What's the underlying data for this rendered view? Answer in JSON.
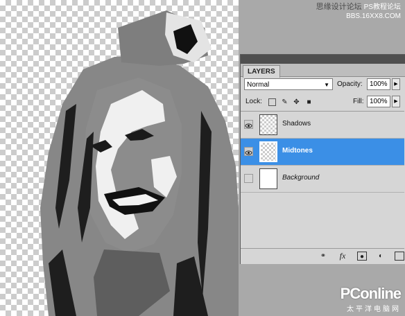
{
  "watermark": {
    "top_text": "思缘设计论坛",
    "top_site": "PS教程论坛",
    "top_url": "BBS.16XX8.COM",
    "bottom_logo": "PConline",
    "bottom_sub": "太平洋电脑网"
  },
  "layers_panel": {
    "tab_label": "LAYERS",
    "blend_mode": "Normal",
    "opacity_label": "Opacity:",
    "opacity_value": "100%",
    "lock_label": "Lock:",
    "fill_label": "Fill:",
    "fill_value": "100%",
    "layers": [
      {
        "name": "Shadows",
        "visible": true,
        "selected": false
      },
      {
        "name": "Midtones",
        "visible": true,
        "selected": true
      },
      {
        "name": "Background",
        "visible": false,
        "selected": false
      }
    ],
    "bottom_icons": [
      "link-icon",
      "fx-icon",
      "mask-icon",
      "adjustment-icon",
      "new-group-icon"
    ],
    "fx_label": "fx"
  },
  "colors": {
    "selection_blue": "#3b8fe6",
    "panel_bg": "#d6d6d6",
    "workspace_gray": "#a9a9a9"
  }
}
